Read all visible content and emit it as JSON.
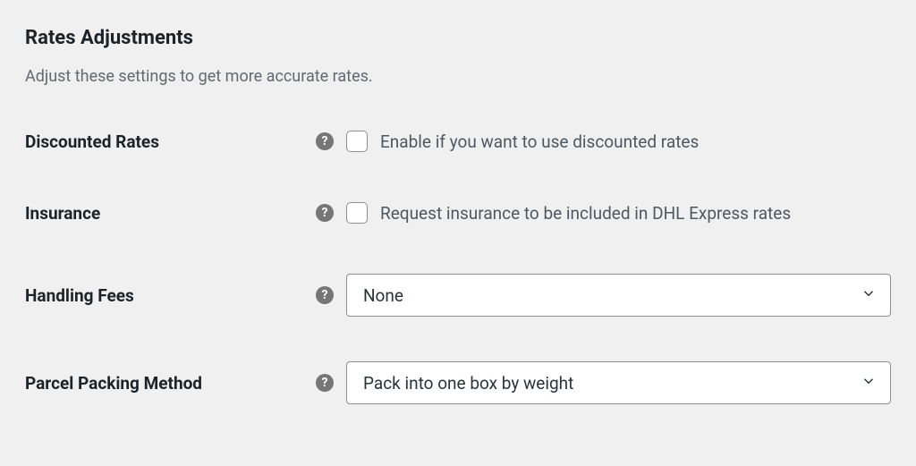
{
  "section": {
    "title": "Rates Adjustments",
    "description": "Adjust these settings to get more accurate rates."
  },
  "fields": {
    "discounted_rates": {
      "label": "Discounted Rates",
      "checkbox_label": "Enable if you want to use discounted rates"
    },
    "insurance": {
      "label": "Insurance",
      "checkbox_label": "Request insurance to be included in DHL Express rates"
    },
    "handling_fees": {
      "label": "Handling Fees",
      "value": "None"
    },
    "parcel_packing": {
      "label": "Parcel Packing Method",
      "value": "Pack into one box by weight"
    }
  }
}
